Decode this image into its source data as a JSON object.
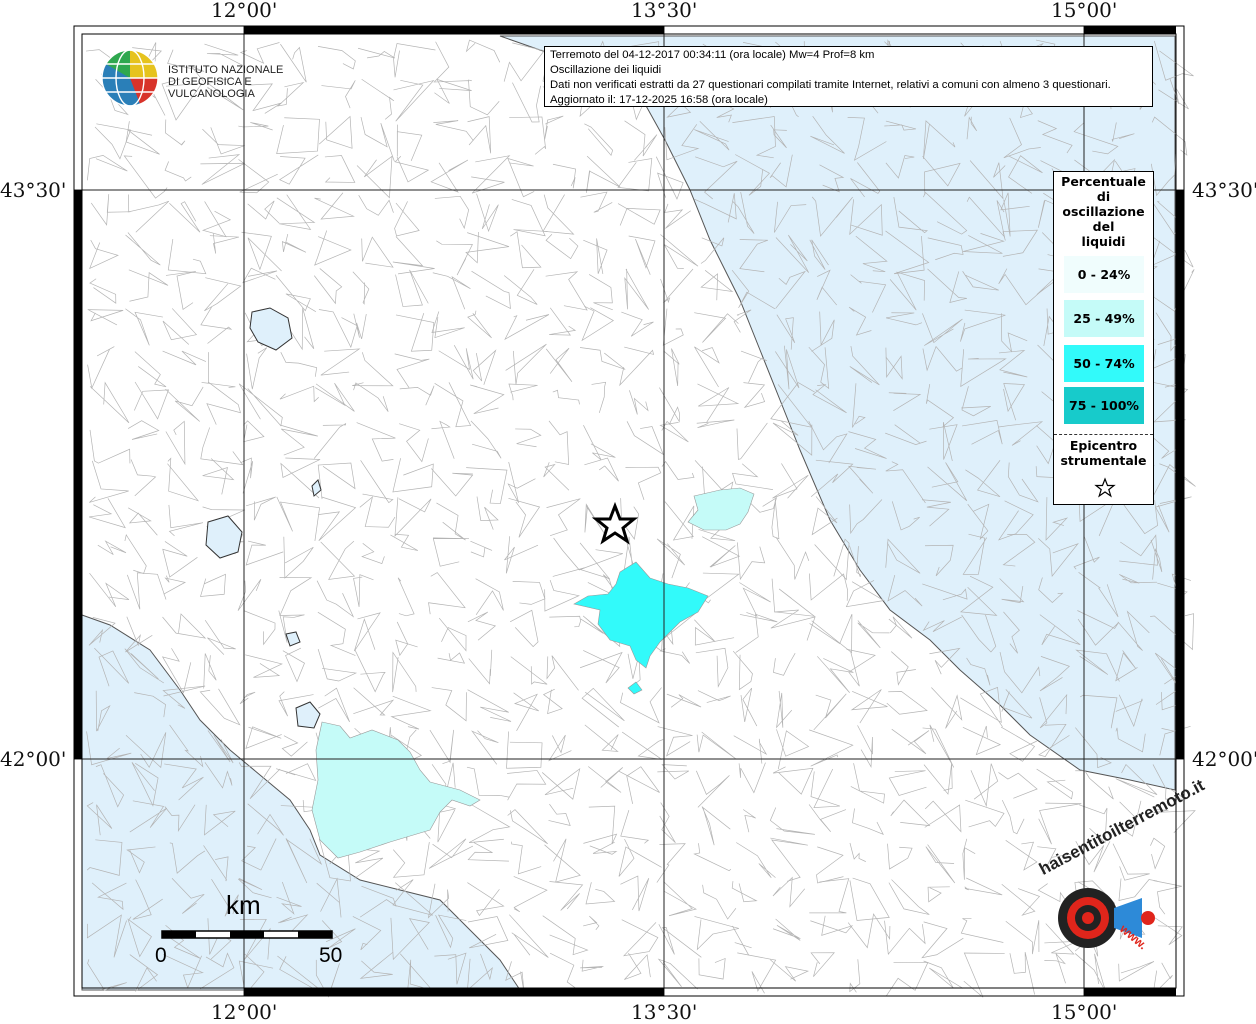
{
  "map": {
    "title_lines": [
      "Terremoto del 04-12-2017 00:34:11 (ora locale) Mw=4 Prof=8 km",
      "Oscillazione dei liquidi",
      "Dati non verificati estratti da 27 questionari compilati tramite Internet, relativi a comuni con almeno 3 questionari.",
      "Aggiornato il: 17-12-2025 16:58 (ora locale)"
    ],
    "lon_labels": [
      "12°00'",
      "13°30'",
      "15°00'"
    ],
    "lat_labels": [
      "43°30'",
      "42°00'"
    ],
    "colors": {
      "sea": "#dff0fb",
      "land": "#ffffff",
      "boundary": "#aaaaaa",
      "class_0_24": "#f0fdfd",
      "class_25_49": "#c5fbf8",
      "class_50_74": "#32fafa",
      "class_75_100": "#17cbcb"
    }
  },
  "logo": {
    "line1": "ISTITUTO NAZIONALE",
    "line2": "DI GEOFISICA E VULCANOLOGIA",
    "icon": "globe-icon"
  },
  "legend": {
    "title": [
      "Percentuale",
      "di",
      "oscillazione",
      "del",
      "liquidi"
    ],
    "classes": [
      {
        "label": "0 - 24%",
        "color": "#f0fdfd"
      },
      {
        "label": "25 - 49%",
        "color": "#c5fbf8"
      },
      {
        "label": "50 - 74%",
        "color": "#32fafa"
      },
      {
        "label": "75 - 100%",
        "color": "#17cbcb"
      }
    ],
    "epicenter": [
      "Epicentro",
      "strumentale"
    ],
    "epicenter_icon": "star-icon"
  },
  "scale": {
    "unit": "km",
    "min": "0",
    "max": "50"
  },
  "watermark": {
    "text": "haisentitoilterremoto.it",
    "url_text": "www.",
    "icon": "target-icon"
  }
}
